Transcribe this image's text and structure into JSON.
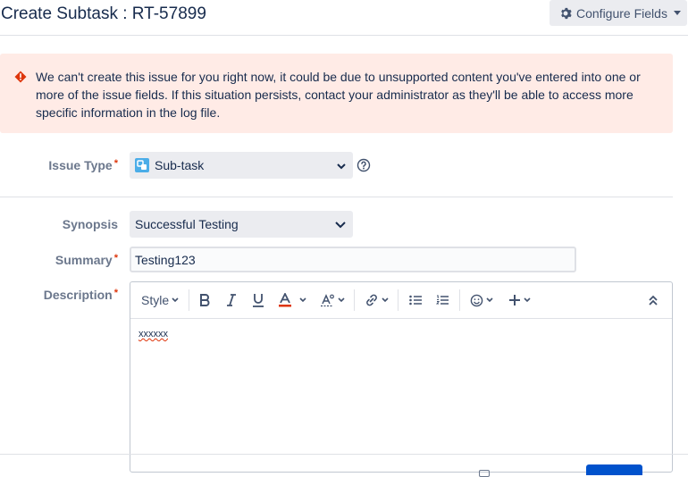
{
  "header": {
    "title": "Create Subtask : RT-57899",
    "configure_label": "Configure Fields"
  },
  "error": {
    "message": "We can't create this issue for you right now, it could be due to unsupported content you've entered into one or more of the issue fields. If this situation persists, contact your administrator as they'll be able to access more specific information in the log file."
  },
  "form": {
    "issue_type": {
      "label": "Issue Type",
      "value": "Sub-task"
    },
    "synopsis": {
      "label": "Synopsis",
      "value": "Successful Testing"
    },
    "summary": {
      "label": "Summary",
      "value": "Testing123"
    },
    "description": {
      "label": "Description",
      "value": "xxxxxx"
    }
  },
  "editor_toolbar": {
    "style_label": "Style"
  },
  "colors": {
    "error_bg": "#ffebe6",
    "error_icon": "#de350b",
    "required": "#de350b",
    "primary": "#0052cc",
    "subtask_icon": "#4bade8"
  }
}
